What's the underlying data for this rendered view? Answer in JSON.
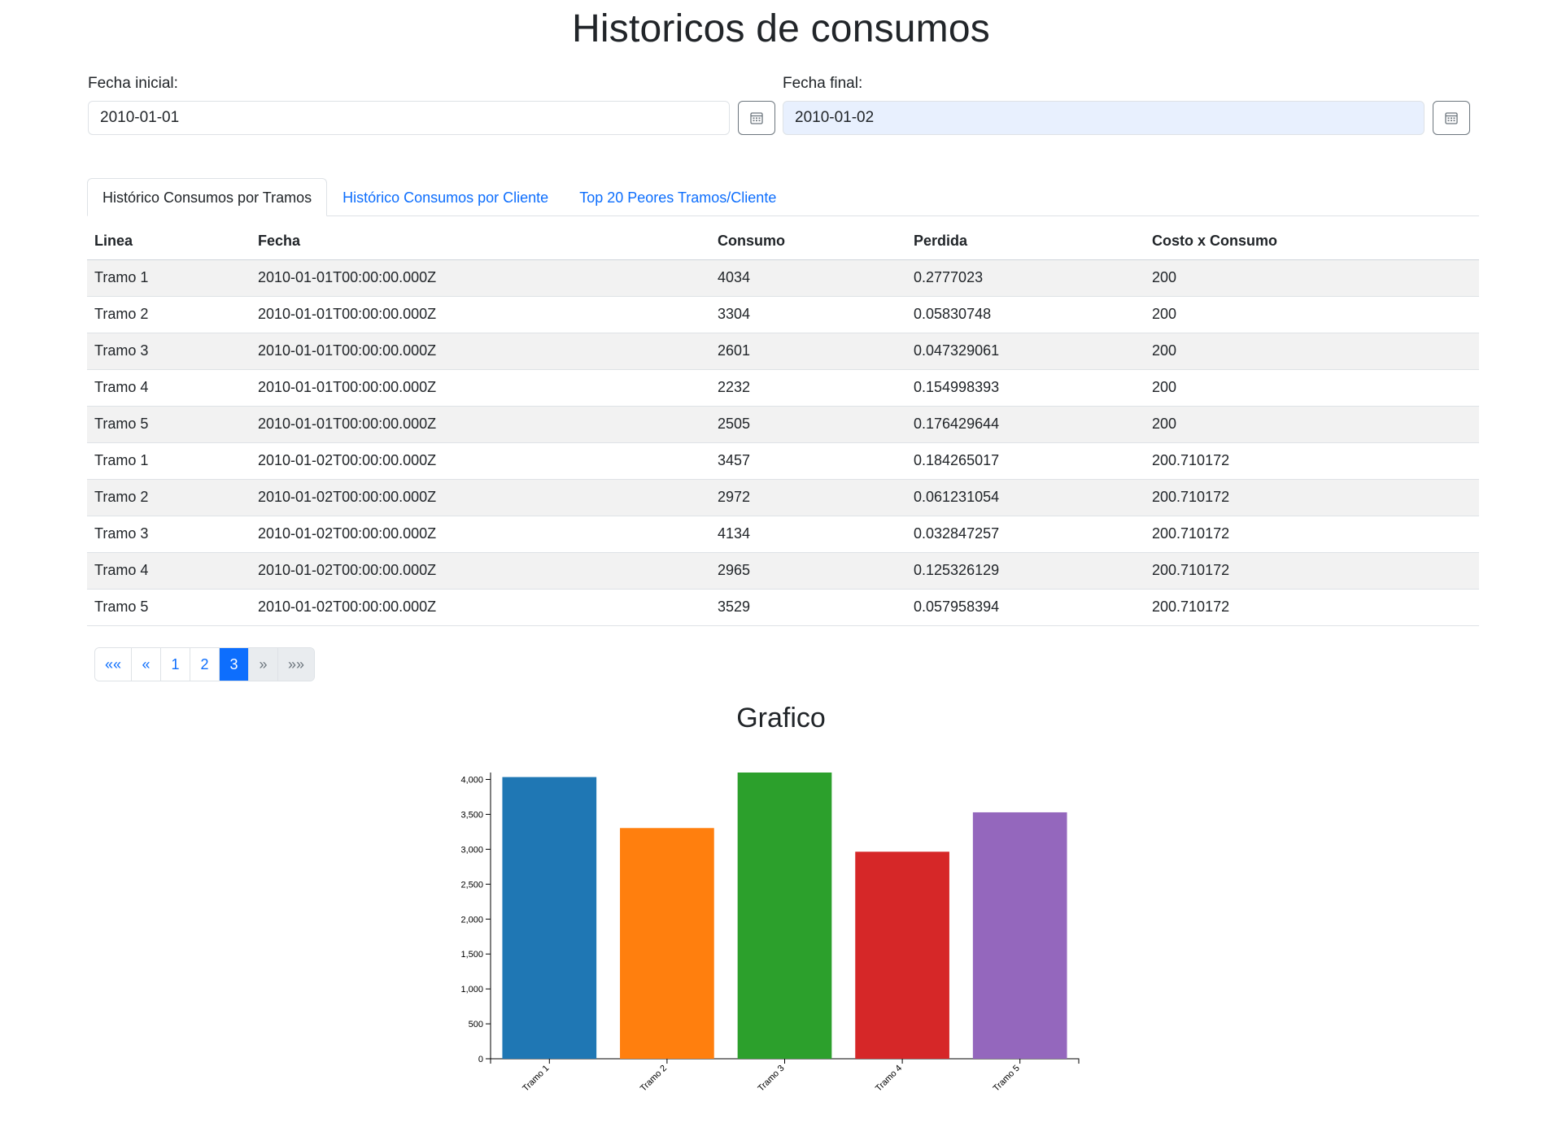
{
  "page_title": "Historicos de consumos",
  "filters": {
    "start": {
      "label": "Fecha inicial:",
      "value": "2010-01-01"
    },
    "end": {
      "label": "Fecha final:",
      "value": "2010-01-02"
    }
  },
  "tabs": [
    {
      "label": "Histórico Consumos por Tramos",
      "active": true
    },
    {
      "label": "Histórico Consumos por Cliente",
      "active": false
    },
    {
      "label": "Top 20 Peores Tramos/Cliente",
      "active": false
    }
  ],
  "table": {
    "headers": [
      "Linea",
      "Fecha",
      "Consumo",
      "Perdida",
      "Costo x Consumo"
    ],
    "rows": [
      [
        "Tramo 1",
        "2010-01-01T00:00:00.000Z",
        "4034",
        "0.2777023",
        "200"
      ],
      [
        "Tramo 2",
        "2010-01-01T00:00:00.000Z",
        "3304",
        "0.05830748",
        "200"
      ],
      [
        "Tramo 3",
        "2010-01-01T00:00:00.000Z",
        "2601",
        "0.047329061",
        "200"
      ],
      [
        "Tramo 4",
        "2010-01-01T00:00:00.000Z",
        "2232",
        "0.154998393",
        "200"
      ],
      [
        "Tramo 5",
        "2010-01-01T00:00:00.000Z",
        "2505",
        "0.176429644",
        "200"
      ],
      [
        "Tramo 1",
        "2010-01-02T00:00:00.000Z",
        "3457",
        "0.184265017",
        "200.710172"
      ],
      [
        "Tramo 2",
        "2010-01-02T00:00:00.000Z",
        "2972",
        "0.061231054",
        "200.710172"
      ],
      [
        "Tramo 3",
        "2010-01-02T00:00:00.000Z",
        "4134",
        "0.032847257",
        "200.710172"
      ],
      [
        "Tramo 4",
        "2010-01-02T00:00:00.000Z",
        "2965",
        "0.125326129",
        "200.710172"
      ],
      [
        "Tramo 5",
        "2010-01-02T00:00:00.000Z",
        "3529",
        "0.057958394",
        "200.710172"
      ]
    ]
  },
  "pagination": {
    "items": [
      {
        "label": "««",
        "state": "normal"
      },
      {
        "label": "«",
        "state": "normal"
      },
      {
        "label": "1",
        "state": "normal"
      },
      {
        "label": "2",
        "state": "normal"
      },
      {
        "label": "3",
        "state": "active"
      },
      {
        "label": "»",
        "state": "disabled"
      },
      {
        "label": "»»",
        "state": "disabled"
      }
    ]
  },
  "chart_section_title": "Grafico",
  "chart_data": {
    "type": "bar",
    "categories": [
      "Tramo 1",
      "Tramo 2",
      "Tramo 3",
      "Tramo 4",
      "Tramo 5"
    ],
    "values": [
      4034,
      3304,
      4134,
      2965,
      3529
    ],
    "colors": [
      "#1f77b4",
      "#ff7f0e",
      "#2ca02c",
      "#d62728",
      "#9467bd"
    ],
    "yticks": [
      "0",
      "500",
      "1,000",
      "1,500",
      "2,000",
      "2,500",
      "3,000",
      "3,500",
      "4,000"
    ],
    "ylim": [
      0,
      4134
    ],
    "grid": false,
    "legend": "none"
  },
  "icons": {
    "calendar": "calendar-icon"
  }
}
